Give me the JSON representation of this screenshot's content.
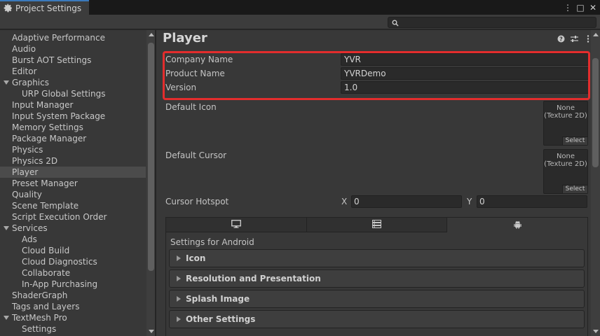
{
  "window": {
    "tab_title": "Project Settings",
    "controls": [
      "⋮",
      "□",
      "✕"
    ]
  },
  "search": {
    "value": "",
    "placeholder": ""
  },
  "sidebar": {
    "items": [
      {
        "label": "Adaptive Performance",
        "level": 0
      },
      {
        "label": "Audio",
        "level": 0
      },
      {
        "label": "Burst AOT Settings",
        "level": 0
      },
      {
        "label": "Editor",
        "level": 0
      },
      {
        "label": "Graphics",
        "level": 0,
        "expanded": true
      },
      {
        "label": "URP Global Settings",
        "level": 1
      },
      {
        "label": "Input Manager",
        "level": 0
      },
      {
        "label": "Input System Package",
        "level": 0
      },
      {
        "label": "Memory Settings",
        "level": 0
      },
      {
        "label": "Package Manager",
        "level": 0
      },
      {
        "label": "Physics",
        "level": 0
      },
      {
        "label": "Physics 2D",
        "level": 0
      },
      {
        "label": "Player",
        "level": 0,
        "selected": true
      },
      {
        "label": "Preset Manager",
        "level": 0
      },
      {
        "label": "Quality",
        "level": 0
      },
      {
        "label": "Scene Template",
        "level": 0
      },
      {
        "label": "Script Execution Order",
        "level": 0
      },
      {
        "label": "Services",
        "level": 0,
        "expanded": true
      },
      {
        "label": "Ads",
        "level": 1
      },
      {
        "label": "Cloud Build",
        "level": 1
      },
      {
        "label": "Cloud Diagnostics",
        "level": 1
      },
      {
        "label": "Collaborate",
        "level": 1
      },
      {
        "label": "In-App Purchasing",
        "level": 1
      },
      {
        "label": "ShaderGraph",
        "level": 0
      },
      {
        "label": "Tags and Layers",
        "level": 0
      },
      {
        "label": "TextMesh Pro",
        "level": 0,
        "expanded": true
      },
      {
        "label": "Settings",
        "level": 1
      }
    ]
  },
  "main": {
    "title": "Player",
    "company": {
      "label": "Company Name",
      "value": "YVR"
    },
    "product": {
      "label": "Product Name",
      "value": "YVRDemo"
    },
    "version": {
      "label": "Version",
      "value": "1.0"
    },
    "default_icon": {
      "label": "Default Icon",
      "line1": "None",
      "line2": "(Texture 2D)",
      "select": "Select"
    },
    "default_cursor": {
      "label": "Default Cursor",
      "line1": "None",
      "line2": "(Texture 2D)",
      "select": "Select"
    },
    "cursor_hotspot": {
      "label": "Cursor Hotspot",
      "x_label": "X",
      "x_value": "0",
      "y_label": "Y",
      "y_value": "0"
    },
    "platform": {
      "tabs": [
        "monitor-icon",
        "server-icon",
        "android-icon"
      ],
      "active_tab": 2,
      "settings_for": "Settings for Android",
      "sections": [
        "Icon",
        "Resolution and Presentation",
        "Splash Image",
        "Other Settings"
      ]
    }
  },
  "colors": {
    "highlight": "#e32d2d",
    "accent": "#3a79bb",
    "panel": "#383838"
  }
}
